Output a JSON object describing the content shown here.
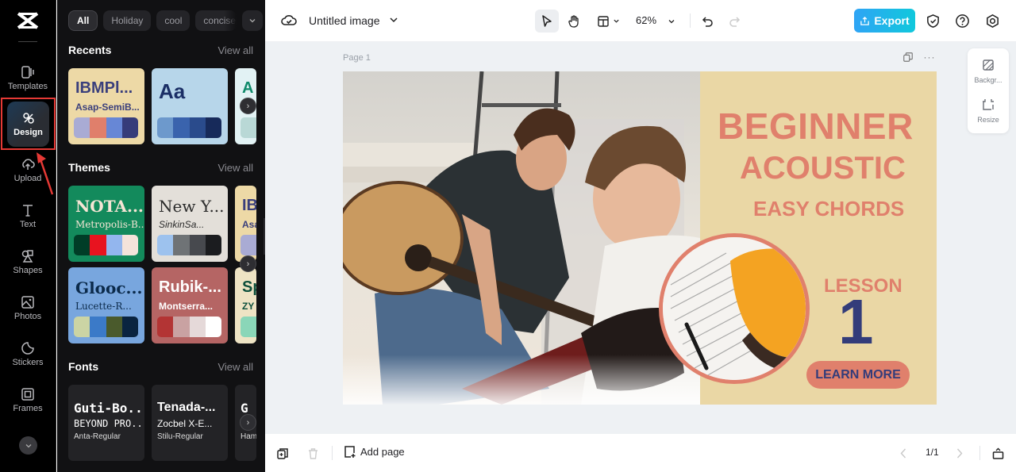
{
  "rail": {
    "items": [
      {
        "label": "Templates",
        "icon": "templates-icon"
      },
      {
        "label": "Design",
        "icon": "design-icon",
        "active": true
      },
      {
        "label": "Upload",
        "icon": "upload-icon"
      },
      {
        "label": "Text",
        "icon": "text-icon"
      },
      {
        "label": "Shapes",
        "icon": "shapes-icon"
      },
      {
        "label": "Photos",
        "icon": "photos-icon"
      },
      {
        "label": "Stickers",
        "icon": "stickers-icon"
      },
      {
        "label": "Frames",
        "icon": "frames-icon"
      }
    ],
    "annotation_color": "#e53935"
  },
  "panel": {
    "chips": [
      "All",
      "Holiday",
      "cool",
      "concise"
    ],
    "recents": {
      "title": "Recents",
      "view_all": "View all",
      "cards": [
        {
          "t1": "IBMPl...",
          "t2": "Asap-SemiB...",
          "bg": "#edd9a6",
          "fg": "#3a3f7c",
          "swatches": [
            "#a9abd4",
            "#e07f6b",
            "#6787d6",
            "#363c7a"
          ]
        },
        {
          "t1": "Aa",
          "t2": "",
          "bg": "#b7d6ea",
          "fg": "#1b2f66",
          "swatches": [
            "#6d99cc",
            "#3a63ad",
            "#2a4b8c",
            "#172a5a"
          ]
        },
        {
          "t1": "A",
          "t2": "",
          "bg": "#e2f2f4",
          "fg": "#0f8a6a",
          "swatches": [
            "#b9d8d6"
          ]
        }
      ]
    },
    "themes": {
      "title": "Themes",
      "view_all": "View all",
      "cards": [
        {
          "t1": "NOTA...",
          "t2": "Metropolis-B...",
          "bg": "#138a5c",
          "fg": "#f6e5d5",
          "swatches": [
            "#003d27",
            "#e8131f",
            "#93b6ee",
            "#f4e3da"
          ]
        },
        {
          "t1": "New Y...",
          "t2": "SinkinSa...",
          "bg": "#e3dfd9",
          "fg": "#2b2b2b",
          "swatches": [
            "#9dc2ee",
            "#6f7376",
            "#47494e",
            "#1b1c1f"
          ]
        },
        {
          "t1": "IB",
          "t2": "Asa",
          "bg": "#edd9a6",
          "fg": "#3a3f7c",
          "swatches": [
            "#a9abd4"
          ]
        },
        {
          "t1": "Glooc...",
          "t2": "Lucette-R...",
          "bg": "#78a6de",
          "fg": "#0b2a4a",
          "swatches": [
            "#cbd4a4",
            "#3b7ac8",
            "#4a5a2c",
            "#0a2440"
          ]
        },
        {
          "t1": "Rubik-...",
          "t2": "Montserra...",
          "bg": "#b56564",
          "fg": "#ffffff",
          "swatches": [
            "#b33434",
            "#c9a2a2",
            "#e5d9d9",
            "#ffffff"
          ]
        },
        {
          "t1": "Sp",
          "t2": "ZY",
          "bg": "#eee3c4",
          "fg": "#0d4f3c",
          "swatches": [
            "#8ad6b8"
          ]
        }
      ]
    },
    "fonts": {
      "title": "Fonts",
      "view_all": "View all",
      "cards": [
        {
          "f1": "Guti-Bo...",
          "f2": "BEYOND PRO...",
          "f3": "Anta-Regular"
        },
        {
          "f1": "Tenada-...",
          "f2": "Zocbel X-E...",
          "f3": "Stilu-Regular"
        },
        {
          "f1": "G",
          "f2": "",
          "f3": "Ham"
        }
      ]
    }
  },
  "topbar": {
    "title": "Untitled image",
    "zoom": "62%",
    "export_label": "Export",
    "export_colors": [
      "#2fa4f5",
      "#10c8dc"
    ]
  },
  "canvas": {
    "page_label": "Page 1",
    "side_tools": [
      "Backgr...",
      "Resize"
    ],
    "design": {
      "line1": "BEGINNER",
      "line2": "ACOUSTIC",
      "line3": "EASY CHORDS",
      "lesson": "LESSON",
      "number": "1",
      "cta": "LEARN MORE",
      "bg_color": "#ead7a5",
      "accent_color": "#e0806c",
      "navy_color": "#333c7a"
    }
  },
  "bottombar": {
    "add_page": "Add page",
    "pager": "1/1"
  }
}
